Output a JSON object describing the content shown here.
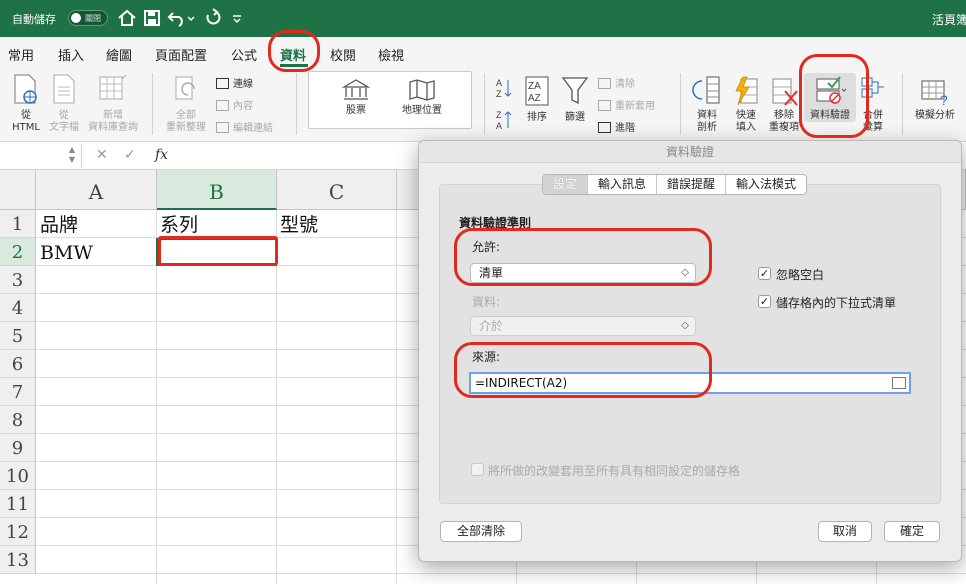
{
  "titlebar": {
    "autosave_label": "自動儲存",
    "autosave_state": "關閉",
    "window_title": "活頁簿"
  },
  "tabs": [
    "常用",
    "插入",
    "繪圖",
    "頁面配置",
    "公式",
    "資料",
    "校閱",
    "檢視"
  ],
  "active_tab": "資料",
  "ribbon": {
    "from_html": "從\nHTML",
    "from_text": "從\n文字檔",
    "new_db_query": "新增\n資料庫查詢",
    "refresh_all": "全部\n重新整理",
    "connections": "連線",
    "properties": "內容",
    "edit_links": "編輯連結",
    "stocks": "股票",
    "geography": "地理位置",
    "sort": "排序",
    "filter": "篩選",
    "clear": "清除",
    "reapply": "重新套用",
    "advanced": "進階",
    "text_to_columns": "資料\n剖析",
    "flash_fill": "快速\n填入",
    "remove_duplicates": "移除\n重複項",
    "data_validation": "資料驗證",
    "consolidate": "合併\n彙算",
    "what_if": "模擬分析"
  },
  "formula_bar": {
    "fx": "fx",
    "cancel": "✕",
    "enter": "✓"
  },
  "sheet": {
    "columns": [
      "A",
      "B",
      "C"
    ],
    "rows": [
      "1",
      "2",
      "3",
      "4",
      "5",
      "6",
      "7",
      "8",
      "9",
      "10",
      "11",
      "12",
      "13"
    ],
    "cells": {
      "A1": "品牌",
      "B1": "系列",
      "C1": "型號",
      "A2": "BMW"
    }
  },
  "dialog": {
    "title": "資料驗證",
    "tabs": [
      "設定",
      "輸入訊息",
      "錯誤提醒",
      "輸入法模式"
    ],
    "active_tab": "設定",
    "criteria_heading": "資料驗證準則",
    "allow_label": "允許:",
    "allow_value": "清單",
    "data_label": "資料:",
    "data_value": "介於",
    "ignore_blank": "忽略空白",
    "in_cell_dropdown": "儲存格內的下拉式清單",
    "source_label": "來源:",
    "source_value": "=INDIRECT(A2)",
    "apply_all": "將所做的改變套用至所有具有相同設定的儲存格",
    "clear_all": "全部清除",
    "cancel": "取消",
    "ok": "確定",
    "check_mark": "✓"
  }
}
